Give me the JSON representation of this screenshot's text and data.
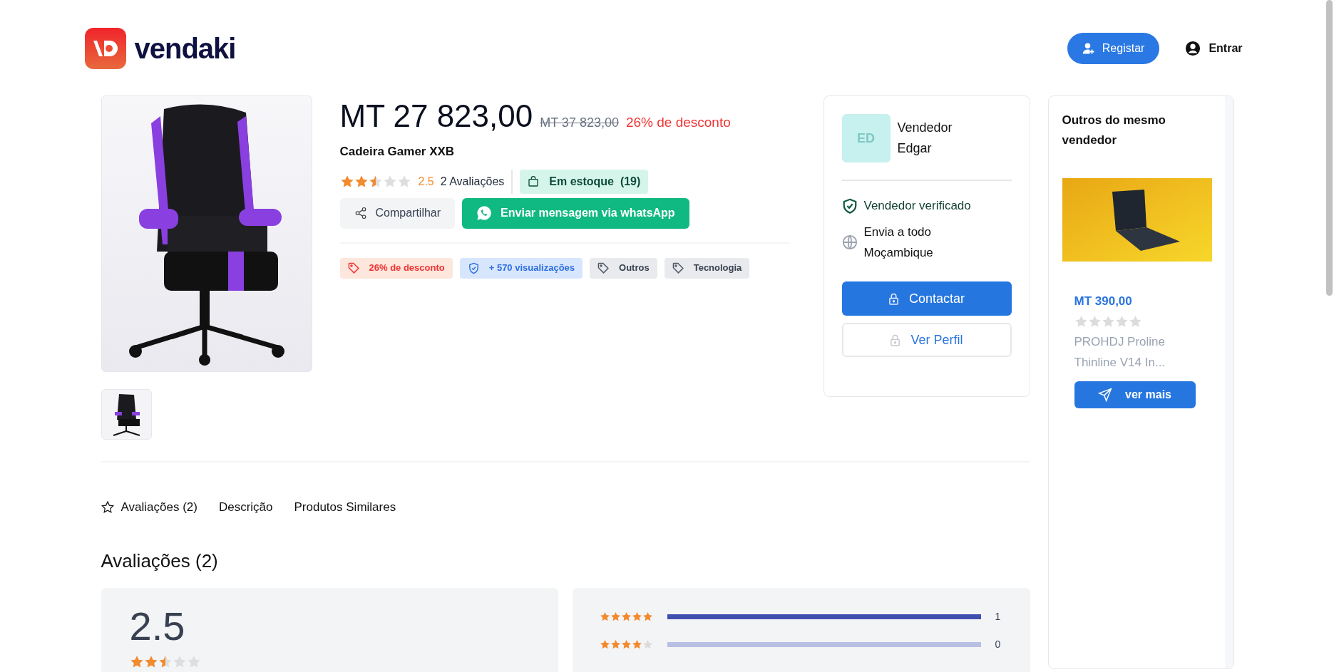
{
  "header": {
    "logo_text": "vendaki",
    "buttons": [
      {
        "label": "Registar",
        "kind": "primary"
      },
      {
        "label": "Entrar",
        "kind": "plain"
      }
    ]
  },
  "product": {
    "price": "MT 27 823,00",
    "old_price": "MT 37 823,00",
    "discount": "26% de desconto",
    "name": "Cadeira Gamer XXB",
    "stars": 2.5,
    "rating": "2.5",
    "reviews": "2 Avaliações",
    "stock": "Em estoque  (19)",
    "actions": [
      {
        "label": "Compartilhar",
        "kind": "share"
      },
      {
        "label": "Enviar mensagem via whatsApp",
        "kind": "whatsapp"
      }
    ],
    "tags": [
      {
        "label": "26% de desconto",
        "kind": "discount"
      },
      {
        "label": "+ 570 visualizações",
        "kind": "views"
      },
      {
        "label": "Outros",
        "kind": "category"
      },
      {
        "label": "Tecnologia",
        "kind": "category"
      }
    ]
  },
  "seller": {
    "initials": "ED",
    "name": "Vendedor Edgar",
    "features": [
      {
        "label": "Vendedor verificado",
        "kind": "verified"
      },
      {
        "label": "Envia a todo Moçambique",
        "kind": "shipping"
      }
    ],
    "buttons": [
      {
        "label": "Contactar",
        "kind": "primary"
      },
      {
        "label": "Ver Perfil",
        "kind": "outline"
      }
    ]
  },
  "sidebar": {
    "title": "Outros do mesmo vendedor",
    "items": [
      {
        "price": "MT 390,00",
        "stars": 0,
        "name": "PROHDJ Proline Thinline V14 In...",
        "button": "ver mais"
      }
    ]
  },
  "tabs": [
    {
      "label": "Avaliações (2)",
      "kind": "star"
    },
    {
      "label": "Descrição",
      "kind": "plain"
    },
    {
      "label": "Produtos Similares",
      "kind": "plain"
    }
  ],
  "reviews": {
    "heading": "Avaliações (2)",
    "average": "2.5",
    "stars": 2.5,
    "distribution": [
      {
        "stars": 5,
        "level": 1,
        "count": "1"
      },
      {
        "stars": 4,
        "level": 0,
        "count": "0"
      }
    ]
  }
}
